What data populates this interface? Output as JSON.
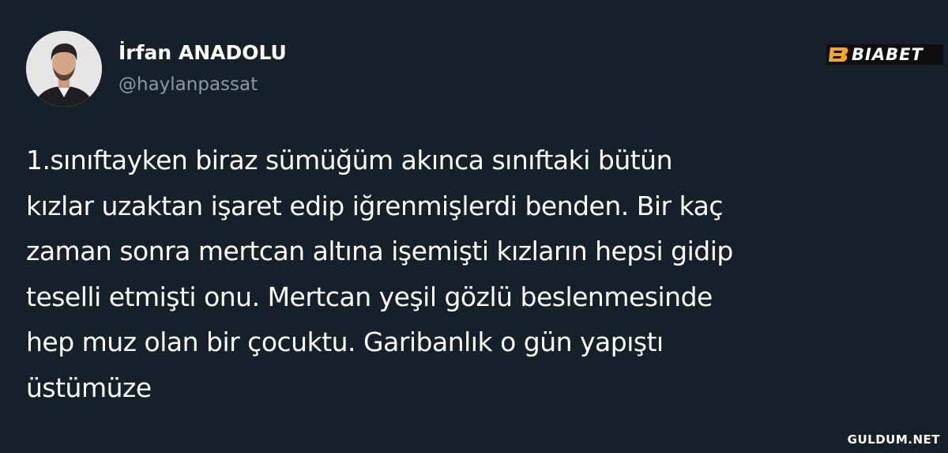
{
  "user": {
    "display_name": "İrfan ANADOLU",
    "handle": "@haylanpassat",
    "avatar": "avatar-photo"
  },
  "brand": {
    "text": "BIABET",
    "icon": "biabet-logo-icon",
    "accent_color": "#f5a623"
  },
  "tweet": {
    "lines": [
      "1.sınıftayken biraz sümüğüm akınca sınıftaki bütün",
      "kızlar uzaktan işaret edip iğrenmişlerdi benden. Bir kaç",
      "zaman sonra mertcan altına işemişti kızların hepsi gidip",
      "teselli etmişti onu. Mertcan yeşil gözlü beslenmesinde",
      "hep muz olan bir çocuktu. Garibanlık o gün yapıştı",
      "üstümüze"
    ]
  },
  "watermark": {
    "text": "GULDUM.NET"
  },
  "colors": {
    "background": "#15202b",
    "text_primary": "#ffffff",
    "text_secondary": "#8899a6"
  }
}
